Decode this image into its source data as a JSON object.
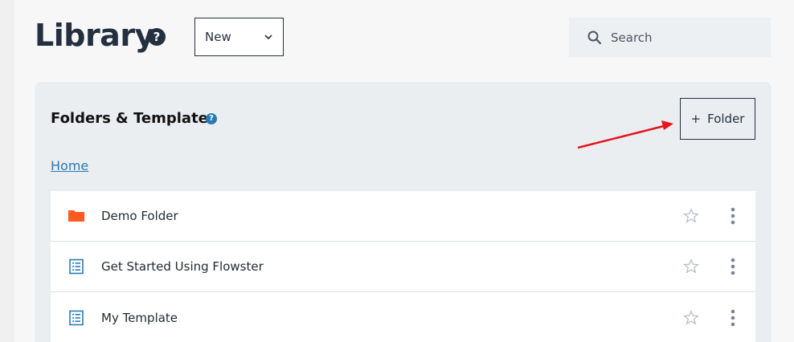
{
  "header": {
    "title": "Library",
    "help_icon": "question-circle-icon",
    "new_select": {
      "label": "New",
      "icon": "chevron-down-icon"
    },
    "search": {
      "placeholder": "Search",
      "icon": "search-icon"
    }
  },
  "panel": {
    "title": "Folders & Templates",
    "help_icon": "question-circle-icon",
    "folder_button": {
      "plus": "+",
      "label": "Folder"
    },
    "breadcrumb": {
      "home": "Home"
    },
    "items": [
      {
        "label": "Demo Folder",
        "icon": "folder-icon"
      },
      {
        "label": "Get Started Using Flowster",
        "icon": "template-icon"
      },
      {
        "label": "My Template",
        "icon": "template-icon"
      }
    ]
  },
  "colors": {
    "accent": "#2a7ab8",
    "folder": "#ff5a1f",
    "annotation_arrow": "#e8141c",
    "text_dark": "#243040"
  }
}
